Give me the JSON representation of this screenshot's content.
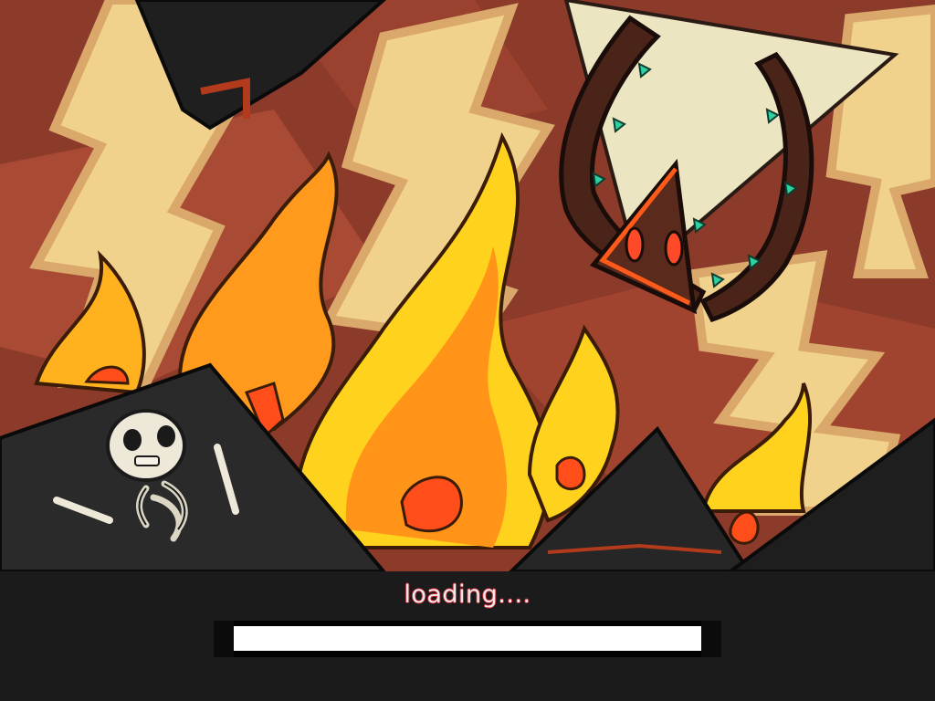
{
  "loading": {
    "label": "loading....",
    "progress": 1.0
  },
  "colors": {
    "background_panel": "#1b1b1b",
    "progress_fill": "#ffffff",
    "text": "#f4e9ea",
    "text_outline": "#c0242f",
    "fire_yellow": "#ffd21e",
    "fire_orange": "#ff9418",
    "lightning_cream": "#f0d28c",
    "backdrop_red": "#8c3a2a"
  },
  "scene": {
    "elements": [
      "lightning-bolts",
      "fire-flames",
      "thorny-vine-creature",
      "skeleton",
      "dark-rocks"
    ]
  }
}
